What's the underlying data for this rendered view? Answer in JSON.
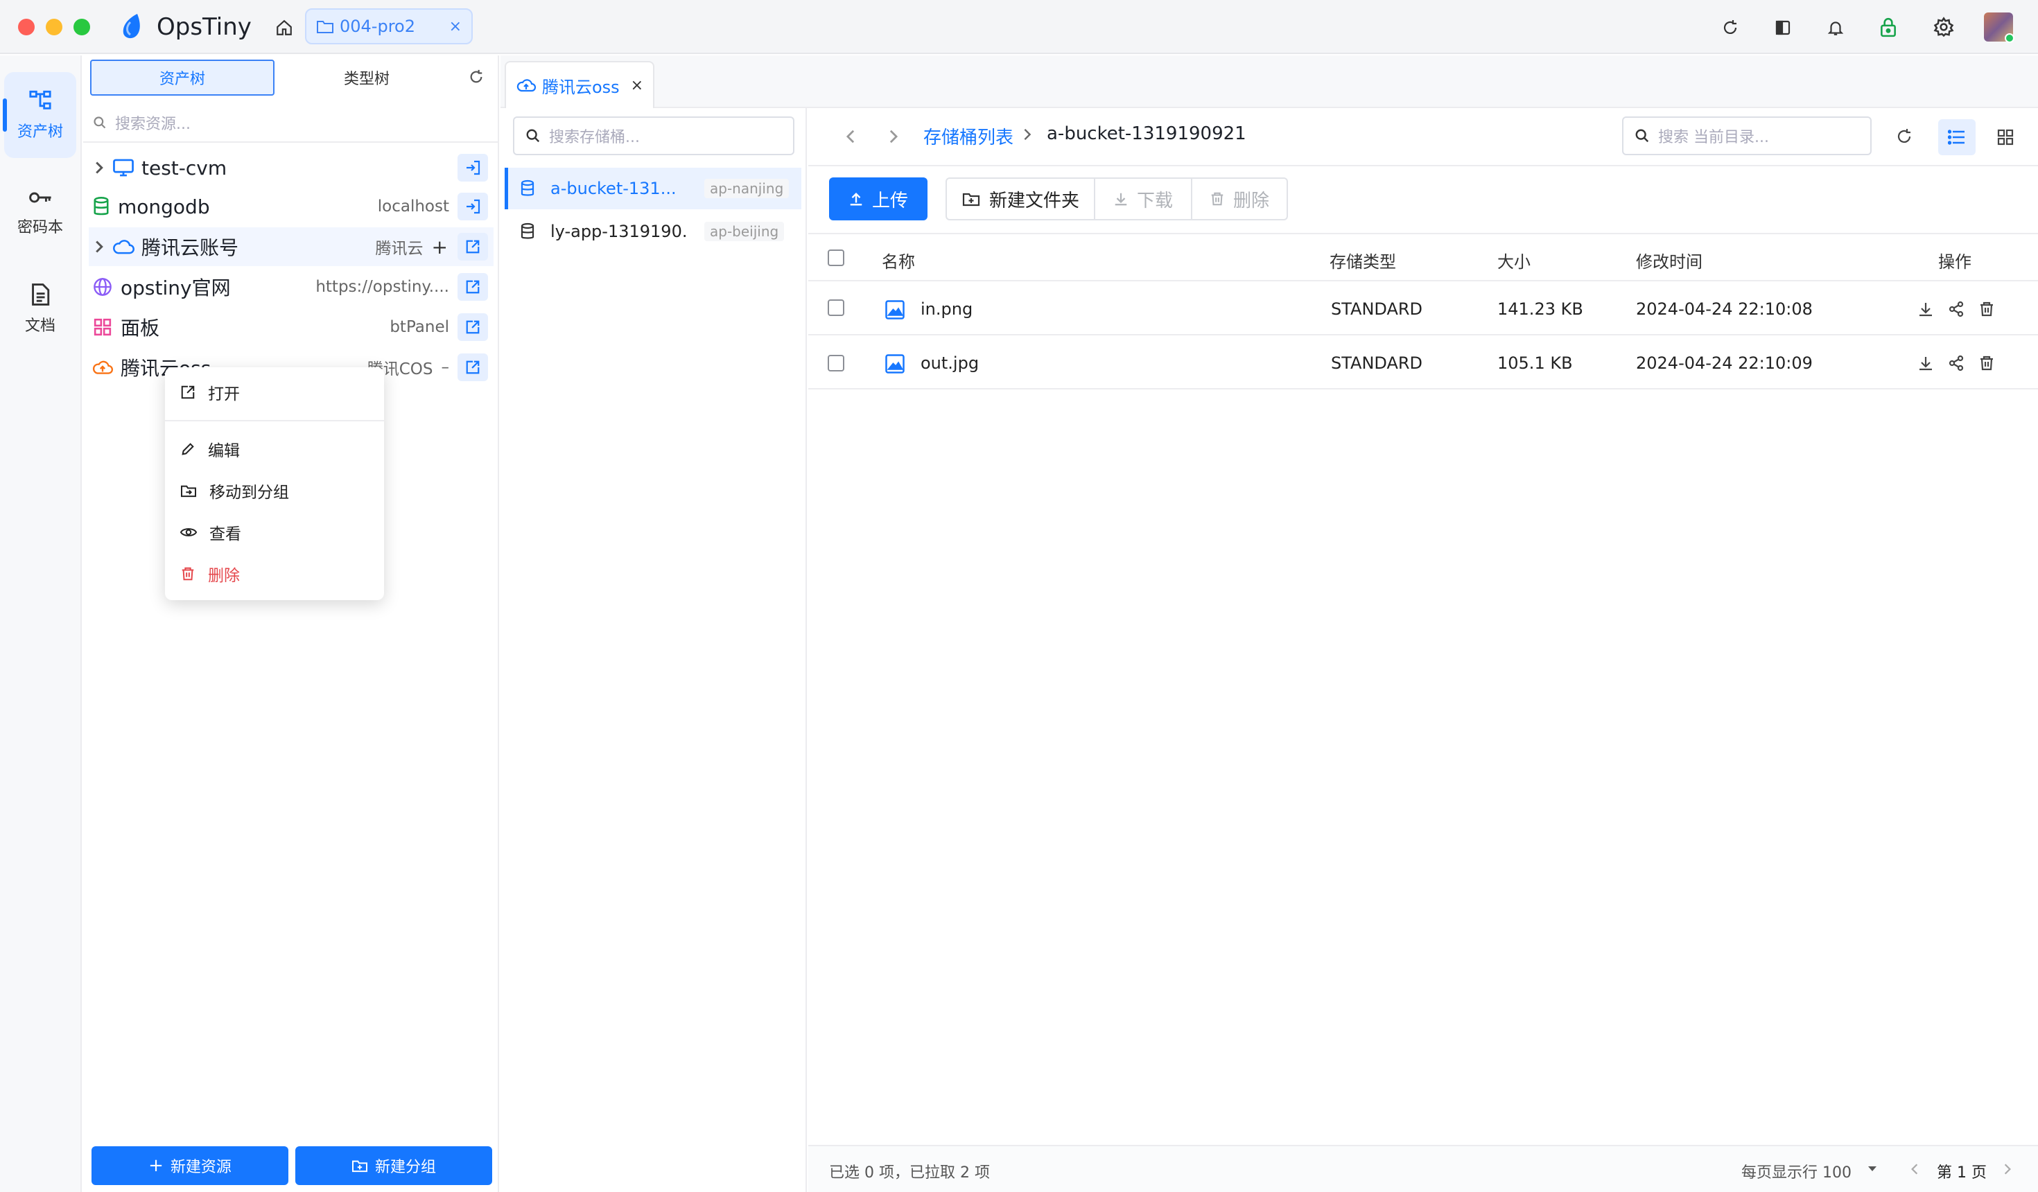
{
  "app": {
    "name": "OpsTiny",
    "path_tab": "004-pro2"
  },
  "rail": {
    "items": [
      {
        "label": "资产树"
      },
      {
        "label": "密码本"
      },
      {
        "label": "文档"
      }
    ]
  },
  "tree": {
    "tabs": [
      "资产树",
      "类型树"
    ],
    "search_placeholder": "搜索资源...",
    "rows": [
      {
        "label": "test-cvm",
        "sub": "",
        "icon": "monitor-icon"
      },
      {
        "label": "mongodb",
        "sub": "localhost",
        "icon": "database-icon"
      },
      {
        "label": "腾讯云账号",
        "sub": "腾讯云",
        "icon": "cloud-icon"
      },
      {
        "label": "opstiny官网",
        "sub": "https://opstiny....",
        "icon": "globe-icon"
      },
      {
        "label": "面板",
        "sub": "btPanel",
        "icon": "dashboard-icon"
      },
      {
        "label": "腾讯云oss",
        "sub": "腾讯COS",
        "icon": "cloud-upload-icon"
      }
    ],
    "new_resource": "新建资源",
    "new_group": "新建分组"
  },
  "context_menu": {
    "items": [
      "打开",
      "编辑",
      "移动到分组",
      "查看",
      "删除"
    ]
  },
  "bucket_tab": {
    "label": "腾讯云oss",
    "search_placeholder": "搜索存储桶...",
    "buckets": [
      {
        "name": "a-bucket-131...",
        "region": "ap-nanjing"
      },
      {
        "name": "ly-app-1319190...",
        "region": "ap-beijing"
      }
    ]
  },
  "files": {
    "breadcrumb_root": "存储桶列表",
    "breadcrumb_current": "a-bucket-1319190921",
    "search_placeholder": "搜索 当前目录...",
    "toolbar": {
      "upload": "上传",
      "new_folder": "新建文件夹",
      "download": "下载",
      "delete": "删除"
    },
    "columns": [
      "名称",
      "存储类型",
      "大小",
      "修改时间",
      "操作"
    ],
    "rows": [
      {
        "name": "in.png",
        "storage": "STANDARD",
        "size": "141.23 KB",
        "modified": "2024-04-24 22:10:08"
      },
      {
        "name": "out.jpg",
        "storage": "STANDARD",
        "size": "105.1 KB",
        "modified": "2024-04-24 22:10:09"
      }
    ],
    "footer_status": "已选 0 项，已拉取 2 项",
    "page_size_label": "每页显示行 100",
    "page_label": "第 1 页"
  },
  "colors": {
    "accent": "#1677ff",
    "danger": "#e5484d",
    "lock_green": "#16a34a"
  }
}
